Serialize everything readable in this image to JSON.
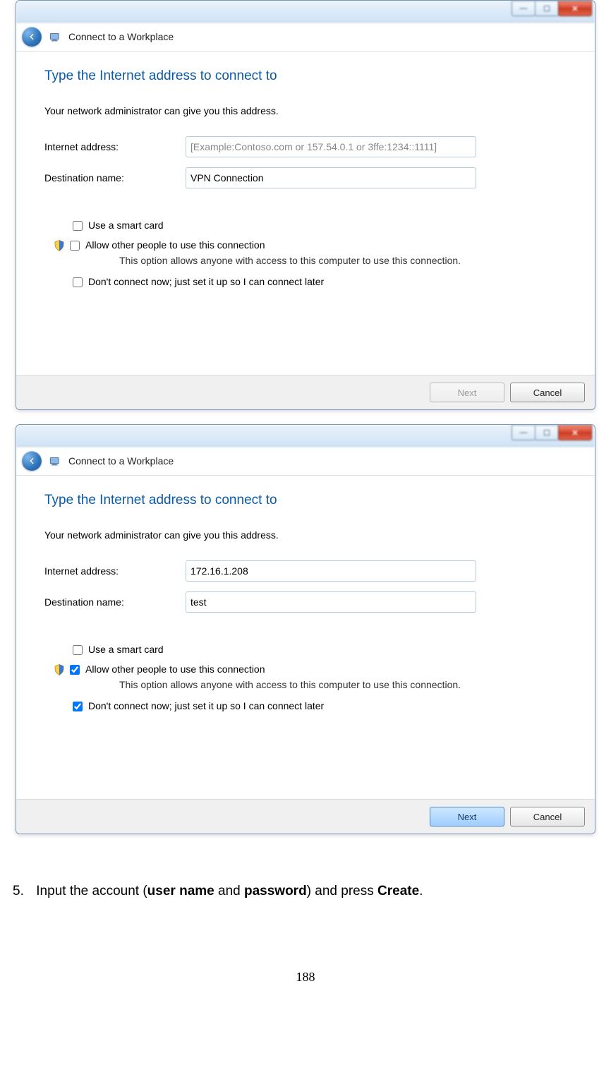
{
  "window1": {
    "blurred_title": "",
    "nav_title": "Connect to a Workplace",
    "heading": "Type the Internet address to connect to",
    "subtext": "Your network administrator can give you this address.",
    "addr_label": "Internet address:",
    "addr_value": "",
    "addr_placeholder": "[Example:Contoso.com or 157.54.0.1 or 3ffe:1234::1111]",
    "dest_label": "Destination name:",
    "dest_value": "VPN Connection",
    "opt_smartcard": "Use a smart card",
    "opt_allow": "Allow other people to use this connection",
    "opt_allow_sub": "This option allows anyone with access to this computer to use this connection.",
    "opt_dont": "Don't connect now; just set it up so I can connect later",
    "chk_smartcard": false,
    "chk_allow": false,
    "chk_dont": false,
    "btn_next": "Next",
    "btn_cancel": "Cancel",
    "next_enabled": false
  },
  "window2": {
    "blurred_title": "",
    "nav_title": "Connect to a Workplace",
    "heading": "Type the Internet address to connect to",
    "subtext": "Your network administrator can give you this address.",
    "addr_label": "Internet address:",
    "addr_value": "172.16.1.208",
    "addr_placeholder": "",
    "dest_label": "Destination name:",
    "dest_value": "test",
    "opt_smartcard": "Use a smart card",
    "opt_allow": "Allow other people to use this connection",
    "opt_allow_sub": "This option allows anyone with access to this computer to use this connection.",
    "opt_dont": "Don't connect now; just set it up so I can connect later",
    "chk_smartcard": false,
    "chk_allow": true,
    "chk_dont": true,
    "btn_next": "Next",
    "btn_cancel": "Cancel",
    "next_enabled": true
  },
  "instruction": {
    "num": "5.",
    "pre": "Input the account (",
    "b1": "user name",
    "mid": " and ",
    "b2": "password",
    "post1": ") and press ",
    "b3": "Create",
    "post2": "."
  },
  "page_number": "188"
}
